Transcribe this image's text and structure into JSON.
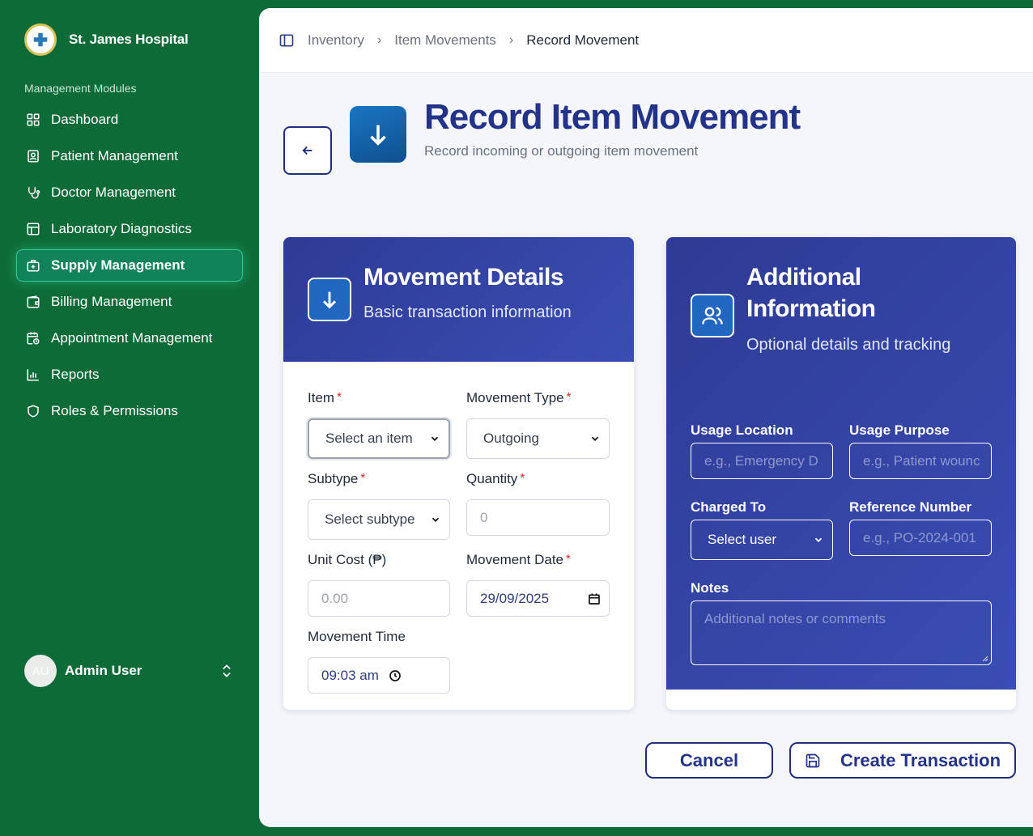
{
  "brand": {
    "name": "St. James Hospital"
  },
  "sidebar": {
    "section_label": "Management Modules",
    "items": [
      {
        "label": "Dashboard",
        "icon": "grid-icon"
      },
      {
        "label": "Patient Management",
        "icon": "id-card-icon"
      },
      {
        "label": "Doctor Management",
        "icon": "stethoscope-icon"
      },
      {
        "label": "Laboratory Diagnostics",
        "icon": "table-icon"
      },
      {
        "label": "Supply Management",
        "icon": "medical-kit-icon",
        "active": true
      },
      {
        "label": "Billing Management",
        "icon": "wallet-icon"
      },
      {
        "label": "Appointment Management",
        "icon": "calendar-clock-icon"
      },
      {
        "label": "Reports",
        "icon": "bar-chart-icon"
      },
      {
        "label": "Roles & Permissions",
        "icon": "shield-icon"
      }
    ],
    "user": {
      "initials": "AU",
      "name": "Admin User"
    }
  },
  "breadcrumb": [
    "Inventory",
    "Item Movements",
    "Record Movement"
  ],
  "page": {
    "title": "Record Item Movement",
    "subtitle": "Record incoming or outgoing item movement"
  },
  "movement_details": {
    "title": "Movement Details",
    "subtitle": "Basic transaction information",
    "item": {
      "label": "Item",
      "value": "Select an item"
    },
    "movement_type": {
      "label": "Movement Type",
      "value": "Outgoing"
    },
    "subtype": {
      "label": "Subtype",
      "value": "Select subtype"
    },
    "quantity": {
      "label": "Quantity",
      "placeholder": "0"
    },
    "unit_cost": {
      "label": "Unit Cost (₱)",
      "placeholder": "0.00"
    },
    "movement_date": {
      "label": "Movement Date",
      "value": "29/09/2025"
    },
    "movement_time": {
      "label": "Movement Time",
      "value": "09:03 am"
    }
  },
  "additional_info": {
    "title_line1": "Additional",
    "title_line2": "Information",
    "subtitle": "Optional details and tracking",
    "usage_location": {
      "label": "Usage Location",
      "placeholder": "e.g., Emergency D"
    },
    "usage_purpose": {
      "label": "Usage Purpose",
      "placeholder": "e.g., Patient wounc"
    },
    "charged_to": {
      "label": "Charged To",
      "value": "Select user"
    },
    "reference_number": {
      "label": "Reference Number",
      "placeholder": "e.g., PO-2024-001"
    },
    "notes": {
      "label": "Notes",
      "placeholder": "Additional notes or comments"
    }
  },
  "actions": {
    "cancel": "Cancel",
    "create": "Create Transaction"
  },
  "colors": {
    "sidebar_bg": "#0d6b38",
    "primary": "#24338a",
    "card_header": "#2e3b95",
    "required": "#e02424"
  }
}
